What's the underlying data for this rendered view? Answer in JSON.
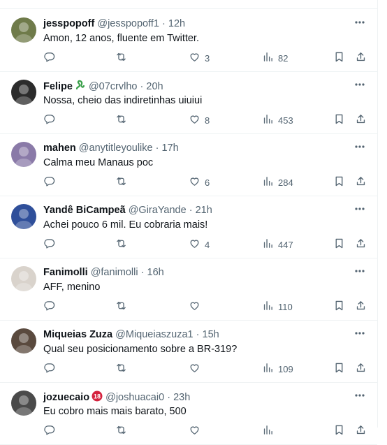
{
  "tweets": [
    {
      "name": "jesspopoff",
      "handle": "@jesspopoff1",
      "time": "12h",
      "text": "Amon, 12 anos, fluente em Twitter.",
      "likes": "3",
      "views": "82",
      "avatar_color": "#6f7b4a",
      "badge": ""
    },
    {
      "name": "Felipe",
      "handle": "@07crvlho",
      "time": "20h",
      "text": "Nossa, cheio das indiretinhas uiuiui",
      "likes": "8",
      "views": "453",
      "avatar_color": "#2b2b2b",
      "badge": "snake"
    },
    {
      "name": "mahen",
      "handle": "@anytitleyoulike",
      "time": "17h",
      "text": "Calma meu Manaus poc",
      "likes": "6",
      "views": "284",
      "avatar_color": "#8a7aa8",
      "badge": ""
    },
    {
      "name": "Yandê BiCampeã",
      "handle": "@GiraYande",
      "time": "21h",
      "text": "Achei pouco 6 mil. Eu cobraria mais!",
      "likes": "4",
      "views": "447",
      "avatar_color": "#2f4f9a",
      "badge": ""
    },
    {
      "name": "Fanimolli",
      "handle": "@fanimolli",
      "time": "16h",
      "text": "AFF, menino",
      "likes": "",
      "views": "110",
      "avatar_color": "#d9d3cc",
      "badge": ""
    },
    {
      "name": "Miqueias Zuza",
      "handle": "@Miqueiaszuza1",
      "time": "15h",
      "text": "Qual seu posicionamento sobre a BR-319?",
      "likes": "",
      "views": "109",
      "avatar_color": "#5a4a3e",
      "badge": ""
    },
    {
      "name": "jozuecaio",
      "handle": "@joshuacai0",
      "time": "23h",
      "text": "Eu cobro mais mais barato, 500",
      "likes": "",
      "views": "",
      "avatar_color": "#4a4a4a",
      "badge": "18"
    }
  ],
  "separator": "·",
  "icons": {
    "reply": "reply-icon",
    "retweet": "retweet-icon",
    "like": "heart-icon",
    "views": "views-icon",
    "bookmark": "bookmark-icon",
    "share": "share-icon",
    "more": "more-icon"
  },
  "colors": {
    "text": "#0f1419",
    "secondary": "#536471",
    "border": "#eff3f4"
  }
}
